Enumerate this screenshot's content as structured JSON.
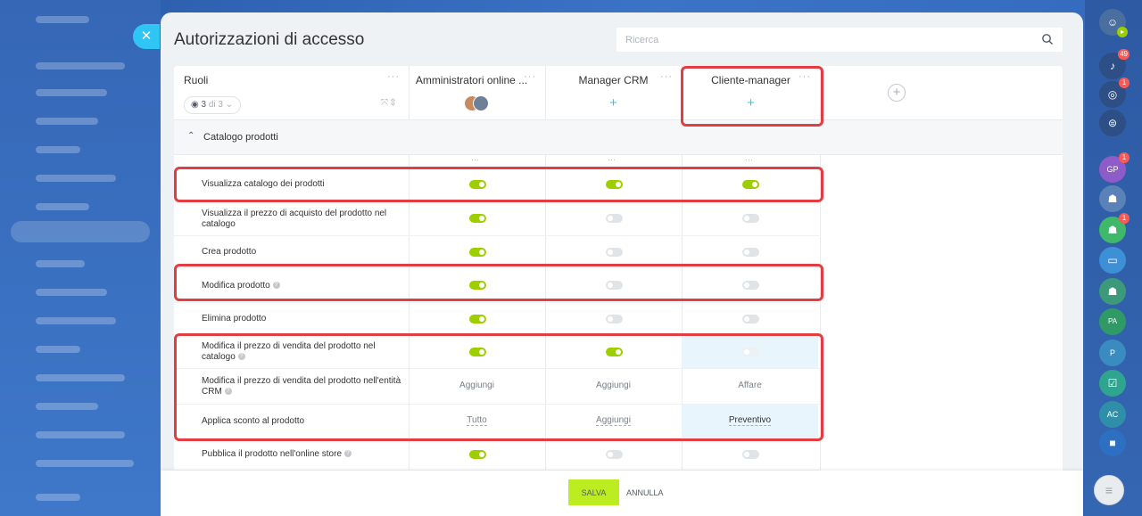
{
  "panel": {
    "title": "Autorizzazioni di accesso",
    "search_placeholder": "Ricerca"
  },
  "roles": {
    "label": "Ruoli",
    "counter_value": "3",
    "counter_suffix": "di 3",
    "columns": [
      {
        "label": "Amministratori online ..."
      },
      {
        "label": "Manager CRM"
      },
      {
        "label": "Cliente-manager"
      }
    ]
  },
  "section": {
    "label": "Catalogo prodotti"
  },
  "permissions": [
    {
      "label": "Visualizza catalogo dei prodotti",
      "help": false,
      "values": [
        "on",
        "on",
        "on"
      ]
    },
    {
      "label": "Visualizza il prezzo di acquisto del prodotto nel catalogo",
      "help": false,
      "values": [
        "on",
        "off",
        "off"
      ]
    },
    {
      "label": "Crea prodotto",
      "help": false,
      "values": [
        "on",
        "off",
        "off"
      ]
    },
    {
      "label": "Modifica prodotto",
      "help": true,
      "values": [
        "on",
        "off",
        "off"
      ]
    },
    {
      "label": "Elimina prodotto",
      "help": false,
      "values": [
        "on",
        "on",
        "off"
      ]
    },
    {
      "label": "Modifica il prezzo di vendita del prodotto nel catalogo",
      "help": true,
      "values": [
        "on",
        "on",
        "off"
      ]
    },
    {
      "label": "Modifica il prezzo di vendita del prodotto nell'entità CRM",
      "help": true,
      "values": [
        "Aggiungi",
        "Aggiungi",
        "Affare"
      ]
    },
    {
      "label": "Applica sconto al prodotto",
      "help": false,
      "values": [
        "Tutto",
        "Aggiungi",
        "Preventivo"
      ]
    },
    {
      "label": "Pubblica il prodotto nell'online store",
      "help": true,
      "values": [
        "on",
        "off",
        "off"
      ]
    }
  ],
  "footer": {
    "save_label": "SALVA",
    "cancel_label": "ANNULLA"
  },
  "rightbar": {
    "notifications_badge": "49",
    "activity_badge": "1",
    "gp_label": "GP",
    "gp_badge": "1",
    "group_badge": "1",
    "pa_label": "PA",
    "p_label": "P",
    "ac_label": "AC"
  },
  "colors": {
    "accent": "#2fc6f6",
    "toggle_on": "#9dcf00",
    "save": "#bbed21",
    "highlight": "#e23e42"
  }
}
